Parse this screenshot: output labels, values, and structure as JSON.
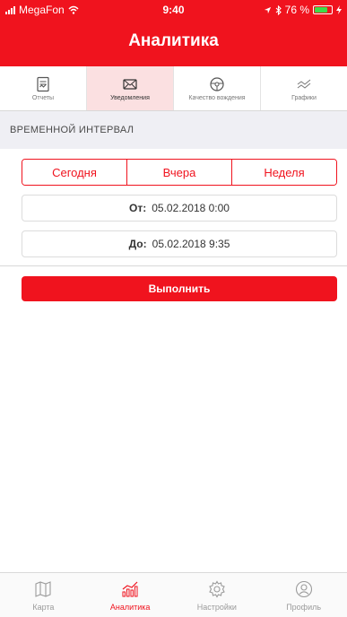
{
  "status_bar": {
    "carrier": "MegaFon",
    "time": "9:40",
    "battery_text": "76 %",
    "battery_level": 0.76
  },
  "nav": {
    "title": "Аналитика"
  },
  "tabs": [
    {
      "label": "Отчеты",
      "icon": "report-icon",
      "active": false
    },
    {
      "label": "Уведомления",
      "icon": "envelope-icon",
      "active": true
    },
    {
      "label": "Качество вождения",
      "icon": "steering-wheel-icon",
      "active": false
    },
    {
      "label": "Графики",
      "icon": "chart-line-icon",
      "active": false
    }
  ],
  "section": {
    "title": "ВРЕМЕННОЙ ИНТЕРВАЛ"
  },
  "segments": [
    {
      "label": "Сегодня"
    },
    {
      "label": "Вчера"
    },
    {
      "label": "Неделя"
    }
  ],
  "date_from": {
    "label": "От:",
    "value": "05.02.2018 0:00"
  },
  "date_to": {
    "label": "До:",
    "value": "05.02.2018 9:35"
  },
  "run_button": {
    "label": "Выполнить"
  },
  "tab_bar": [
    {
      "label": "Карта",
      "icon": "map-icon",
      "active": false
    },
    {
      "label": "Аналитика",
      "icon": "analytics-icon",
      "active": true
    },
    {
      "label": "Настройки",
      "icon": "settings-gear-icon",
      "active": false
    },
    {
      "label": "Профиль",
      "icon": "profile-icon",
      "active": false
    }
  ],
  "colors": {
    "accent": "#f0131e",
    "battery": "#3ddc4a",
    "section_bg": "#efeff4"
  }
}
